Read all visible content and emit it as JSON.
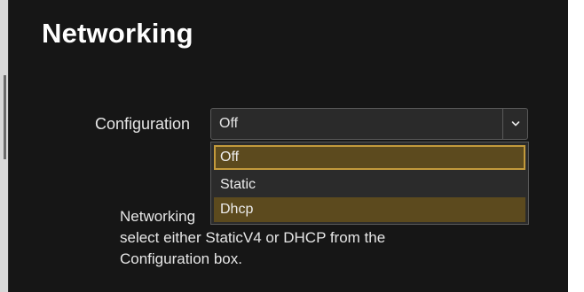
{
  "page": {
    "title": "Networking"
  },
  "configuration": {
    "label": "Configuration",
    "selected_value": "Off",
    "arrow_icon": "chevron-down-icon",
    "options": [
      {
        "label": "Off"
      },
      {
        "label": "Static"
      },
      {
        "label": "Dhcp"
      }
    ]
  },
  "info": {
    "line1": "Networking",
    "line2": "select either StaticV4 or DHCP from the",
    "line3": "Configuration box."
  },
  "colors": {
    "panel_background": "#161616",
    "option_highlight": "#5c4a1e",
    "focus_border": "#c39a3c"
  }
}
